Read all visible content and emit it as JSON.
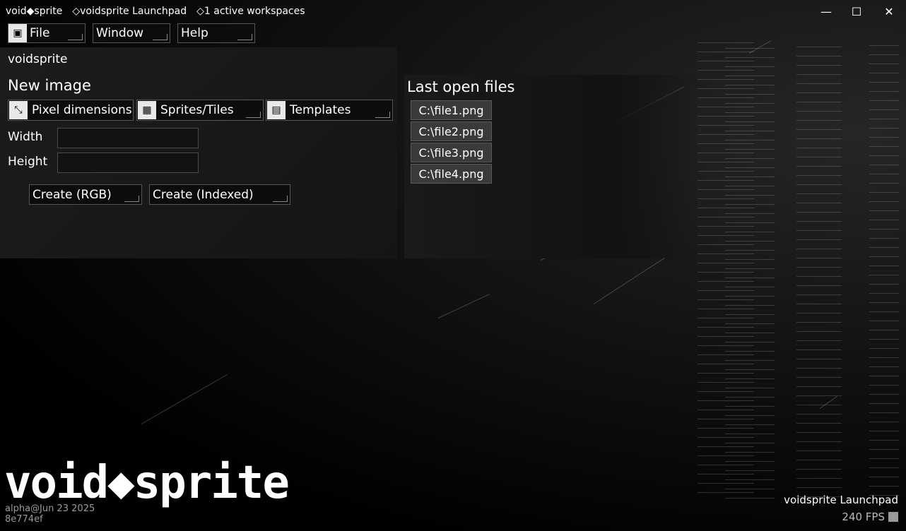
{
  "titlebar": {
    "app_icon": "diamond-icon",
    "app_name": "void◆sprite",
    "tab_launchpad": "◇voidsprite Launchpad",
    "tab_workspaces": "◇1 active workspaces",
    "minimize": "—",
    "maximize": "☐",
    "close": "✕"
  },
  "menu": {
    "file": "File",
    "window": "Window",
    "help": "Help"
  },
  "launchpad": {
    "header": "voidsprite",
    "new_image_title": "New image",
    "tabs": [
      {
        "label": "Pixel dimensions",
        "icon": "resize-icon"
      },
      {
        "label": "Sprites/Tiles",
        "icon": "sprites-icon"
      },
      {
        "label": "Templates",
        "icon": "templates-icon"
      }
    ],
    "width_label": "Width",
    "height_label": "Height",
    "width_value": "",
    "height_value": "",
    "create_rgb": "Create (RGB)",
    "create_indexed": "Create (Indexed)"
  },
  "recent": {
    "title": "Last open files",
    "files": [
      "C:\\file1.png",
      "C:\\file2.png",
      "C:\\file3.png",
      "C:\\file4.png"
    ]
  },
  "footer": {
    "logo": "void◆sprite",
    "build_date": "alpha@Jun 23 2025",
    "build_hash": "8e774ef",
    "status": "voidsprite Launchpad",
    "fps": "240 FPS"
  },
  "colors": {
    "background": "#000000",
    "panel": "#1a1a1a",
    "file_item": "#3a3a3a",
    "text": "#ffffff"
  }
}
